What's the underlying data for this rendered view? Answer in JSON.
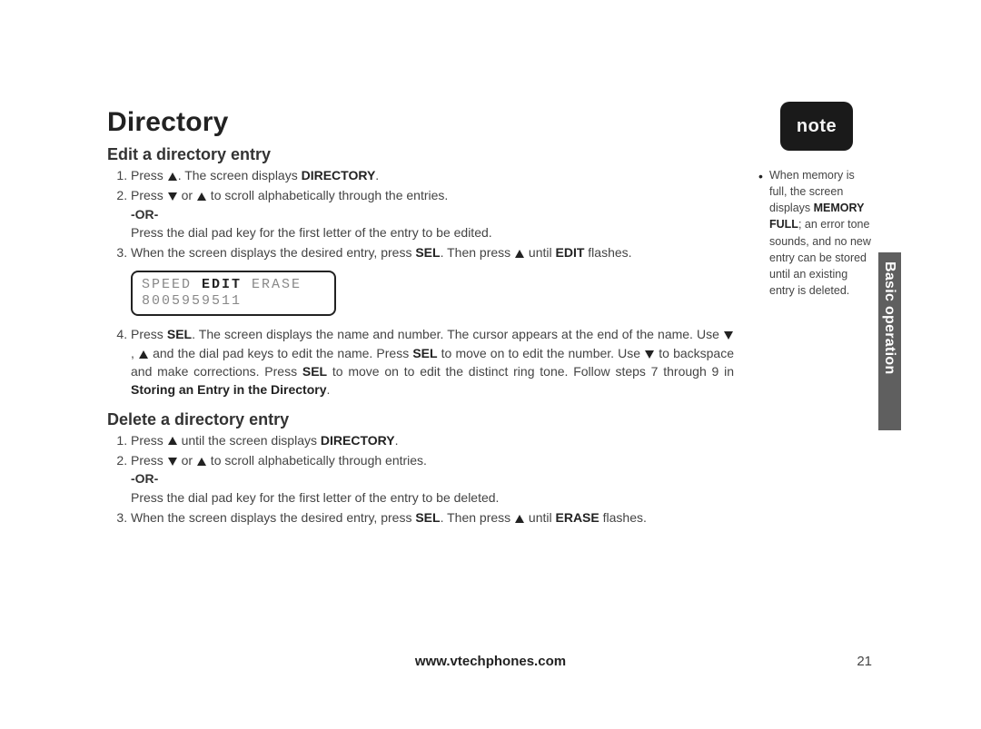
{
  "title": "Directory",
  "edit": {
    "heading": "Edit a directory entry",
    "step1_a": "Press ",
    "step1_b": ". The screen displays ",
    "step1_c": "DIRECTORY",
    "step1_d": ".",
    "step2_a": "Press ",
    "step2_b": " or ",
    "step2_c": " to scroll alphabetically through the entries.",
    "or": "-OR-",
    "step2_alt": "Press the dial pad key for the first letter of the entry to be edited.",
    "step3_a": "When the screen displays the desired entry, press ",
    "step3_b": "SEL",
    "step3_c": ". Then press ",
    "step3_d": " until ",
    "step3_e": "EDIT",
    "step3_f": " flashes.",
    "lcd_speed": "SPEED ",
    "lcd_edit": "EDIT",
    "lcd_erase": " ERASE",
    "lcd_number": "8005959511",
    "step4_a": "Press ",
    "step4_b": "SEL",
    "step4_c": ". The screen displays the name and number. The cursor appears at the end of the name. Use ",
    "step4_d": ", ",
    "step4_e": " and the dial pad keys to edit the name. Press ",
    "step4_f": "SEL",
    "step4_g": " to move on to edit the number. Use ",
    "step4_h": " to backspace and make corrections. Press ",
    "step4_i": "SEL",
    "step4_j": " to move on to edit the distinct ring tone. Follow steps 7 through 9 in ",
    "step4_k": "Storing an Entry in the Directory",
    "step4_l": "."
  },
  "delete": {
    "heading": "Delete a directory entry",
    "step1_a": "Press ",
    "step1_b": " until the screen displays ",
    "step1_c": "DIRECTORY",
    "step1_d": ".",
    "step2_a": "Press ",
    "step2_b": " or ",
    "step2_c": " to scroll alphabetically through entries.",
    "or": "-OR-",
    "step2_alt": "Press the dial pad key for the first letter of the entry to be deleted.",
    "step3_a": "When the screen displays the desired entry, press ",
    "step3_b": "SEL",
    "step3_c": ". Then press ",
    "step3_d": " until ",
    "step3_e": "ERASE",
    "step3_f": " flashes."
  },
  "note": {
    "label": "note",
    "text_a": "When memory is full, the screen displays ",
    "text_b": "MEMORY FULL",
    "text_c": "; an error tone sounds, and no new entry can be stored until an existing entry is deleted."
  },
  "tab": "Basic operation",
  "footer_url": "www.vtechphones.com",
  "page_number": "21"
}
